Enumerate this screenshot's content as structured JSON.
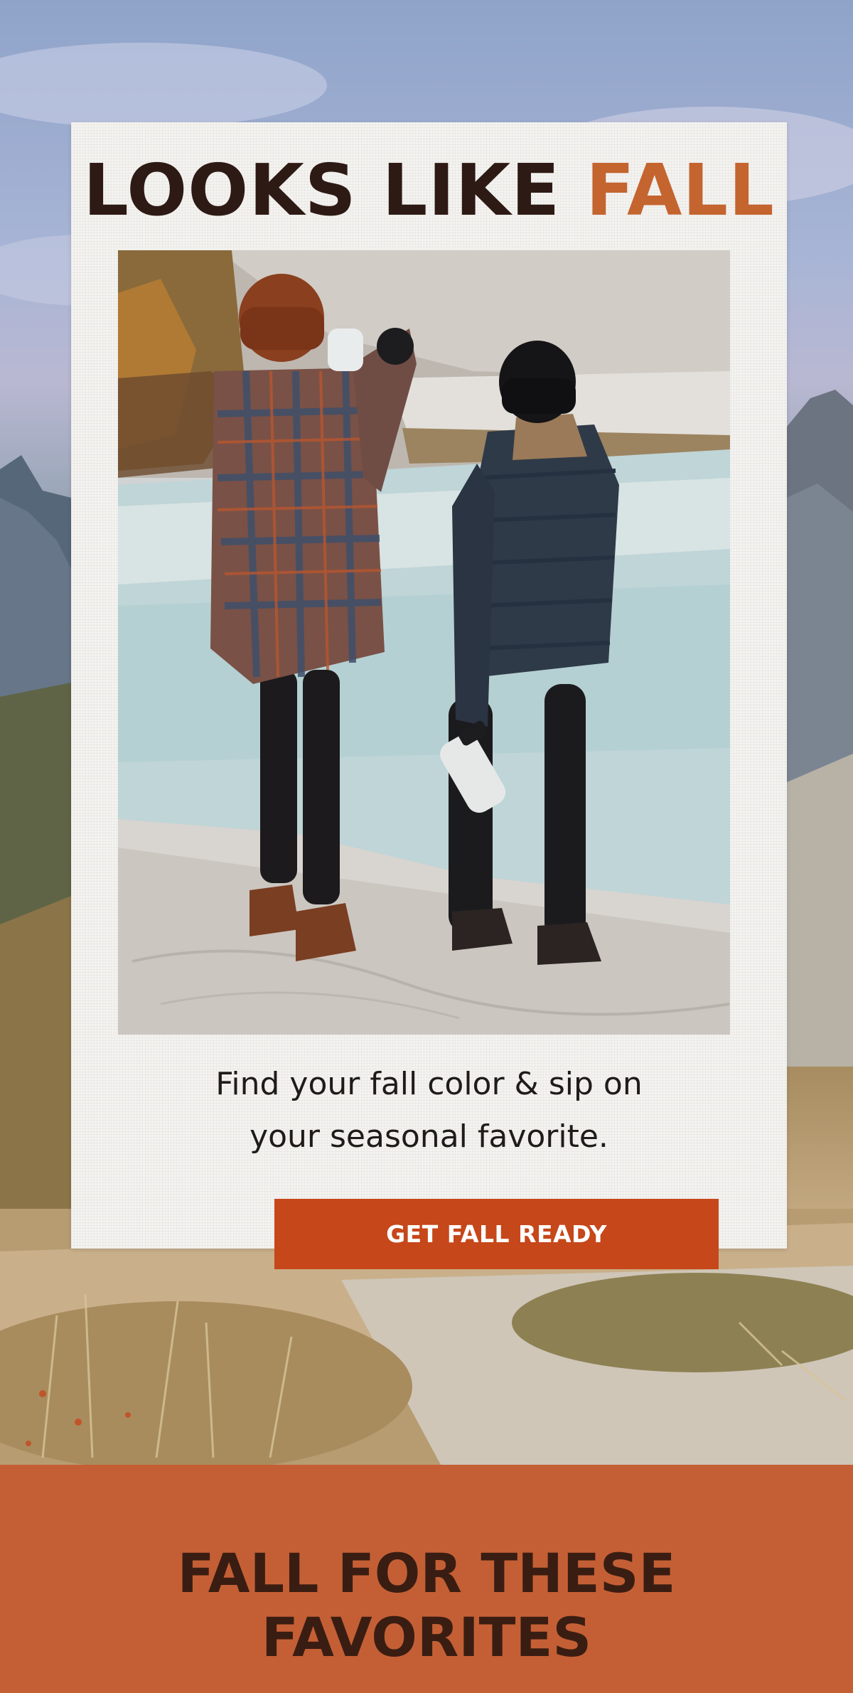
{
  "hero": {
    "headline_main": "LOOKS LIKE ",
    "headline_accent": "FALL",
    "body_line1": "Find your fall color & sip on",
    "body_line2": "your seasonal favorite.",
    "cta_label": "GET FALL READY"
  },
  "section": {
    "title_line1": "FALL FOR THESE",
    "title_line2": "FAVORITES"
  },
  "colors": {
    "headline_dark": "#2e1a14",
    "headline_accent": "#c4642f",
    "cta_background": "#c6471a",
    "band_background": "#c45f35",
    "band_title": "#3a1d12"
  }
}
